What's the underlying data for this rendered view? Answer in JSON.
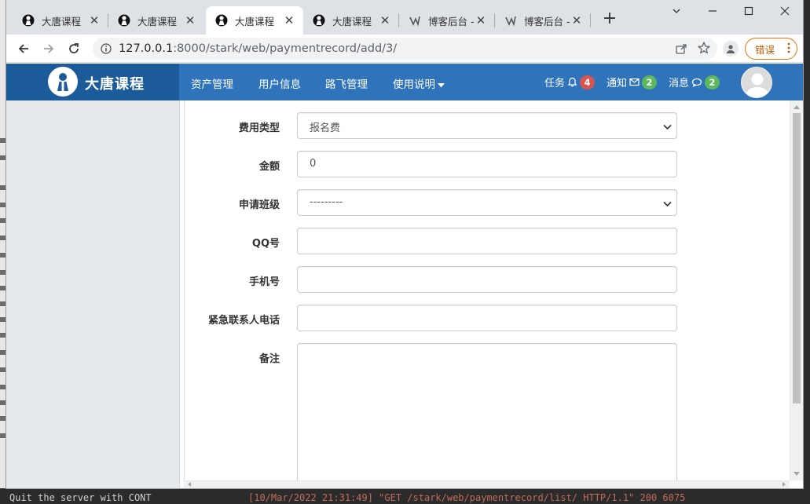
{
  "browser": {
    "tabs": [
      {
        "title": "大唐课程",
        "favicon": "person-logo-icon",
        "active": false
      },
      {
        "title": "大唐课程",
        "favicon": "person-logo-icon",
        "active": false
      },
      {
        "title": "大唐课程",
        "favicon": "person-logo-icon",
        "active": true
      },
      {
        "title": "大唐课程",
        "favicon": "person-logo-icon",
        "active": false
      },
      {
        "title": "博客后台 -",
        "favicon": "blog-logo-icon",
        "active": false
      },
      {
        "title": "博客后台 -",
        "favicon": "blog-logo-icon",
        "active": false
      }
    ],
    "close_glyph": "✕",
    "new_tab_glyph": "+",
    "url": {
      "host": "127.0.0.1",
      "path": ":8000/stark/web/paymentrecord/add/3/"
    },
    "error_button_label": "错误",
    "error_button_color": "#e8710a"
  },
  "site": {
    "brand_name": "大唐课程",
    "nav_color": "#2f73ba",
    "brand_color": "#1c5b9a",
    "menu": [
      {
        "label": "资产管理"
      },
      {
        "label": "用户信息"
      },
      {
        "label": "路飞管理"
      },
      {
        "label": "使用说明",
        "dropdown": true
      }
    ],
    "stats": [
      {
        "label": "任务",
        "icon": "bell-icon",
        "count": "4",
        "badge_color": "#d9534f"
      },
      {
        "label": "通知",
        "icon": "envelope-icon",
        "count": "2",
        "badge_color": "#5cb85c"
      },
      {
        "label": "消息",
        "icon": "comment-icon",
        "count": "2",
        "badge_color": "#5cb85c"
      }
    ]
  },
  "form": {
    "fields": [
      {
        "label": "费用类型",
        "type": "select",
        "value": "报名费"
      },
      {
        "label": "金额",
        "type": "input",
        "value": "0"
      },
      {
        "label": "申请班级",
        "type": "select",
        "value": "---------"
      },
      {
        "label": "QQ号",
        "type": "input",
        "value": ""
      },
      {
        "label": "手机号",
        "type": "input",
        "value": ""
      },
      {
        "label": "紧急联系人电话",
        "type": "input",
        "value": ""
      },
      {
        "label": "备注",
        "type": "textarea",
        "value": ""
      }
    ]
  },
  "background_terminal": {
    "line_left": "Quit the server with CONT",
    "line_right": "[10/Mar/2022 21:31:49] \"GET /stark/web/paymentrecord/list/ HTTP/1.1\" 200 6075"
  }
}
